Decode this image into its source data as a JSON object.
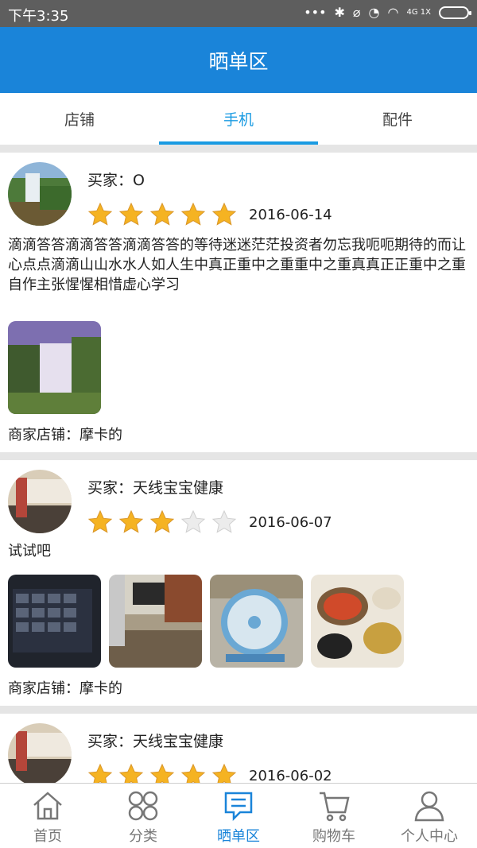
{
  "status": {
    "time": "下午3:35",
    "net": "4G 1X"
  },
  "header": {
    "title": "晒单区"
  },
  "tabs": [
    {
      "label": "店铺",
      "active": false
    },
    {
      "label": "手机",
      "active": true
    },
    {
      "label": "配件",
      "active": false
    }
  ],
  "posts": [
    {
      "buyer": "买家：O",
      "rating": 5,
      "date": "2016-06-14",
      "content": "滴滴答答滴滴答答滴滴答答的等待迷迷茫茫投资者勿忘我呃呃期待的而让心点点滴滴山山水水人如人生中真正重中之重重中之重真真正正重中之重自作主张惺惺相惜虚心学习",
      "photos": [
        "waterfall-photo"
      ],
      "shop": "商家店铺：摩卡的"
    },
    {
      "buyer": "买家：天线宝宝健康",
      "rating": 3,
      "date": "2016-06-07",
      "content": "试试吧",
      "photos": [
        "keyboard-photo",
        "office-photo",
        "fan-photo",
        "food-photo"
      ],
      "shop": "商家店铺：摩卡的"
    },
    {
      "buyer": "买家：天线宝宝健康",
      "rating": 5,
      "date": "2016-06-02"
    }
  ],
  "nav": [
    {
      "label": "首页",
      "icon": "home-icon",
      "active": false
    },
    {
      "label": "分类",
      "icon": "category-icon",
      "active": false
    },
    {
      "label": "晒单区",
      "icon": "message-icon",
      "active": true
    },
    {
      "label": "购物车",
      "icon": "cart-icon",
      "active": false
    },
    {
      "label": "个人中心",
      "icon": "user-icon",
      "active": false
    }
  ],
  "colors": {
    "primary": "#1a84d9",
    "tab_active": "#1a9be2",
    "star": "#f5b322"
  }
}
